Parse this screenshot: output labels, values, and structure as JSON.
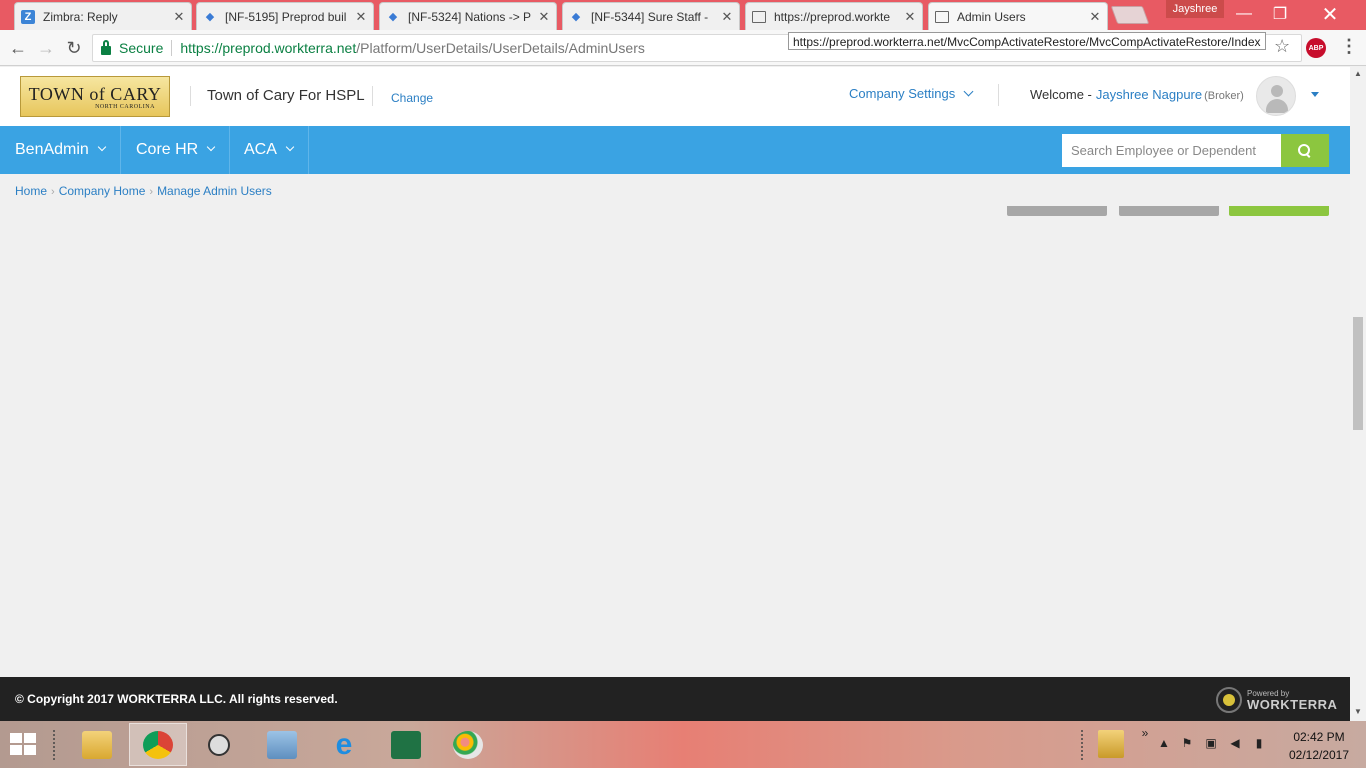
{
  "browser": {
    "tabs": [
      {
        "title": "Zimbra: Reply",
        "icon": "zimbra-icon"
      },
      {
        "title": "[NF-5195] Preprod buil",
        "icon": "jira-icon"
      },
      {
        "title": "[NF-5324] Nations -> P",
        "icon": "jira-icon"
      },
      {
        "title": "[NF-5344] Sure Staff - ",
        "icon": "jira-icon"
      },
      {
        "title": "https://preprod.workte",
        "icon": "page-icon"
      },
      {
        "title": "Admin Users",
        "icon": "page-icon"
      }
    ],
    "profile_name": "Jayshree",
    "secure_label": "Secure",
    "url_host": "https://preprod.workterra.net",
    "url_path": "/Platform/UserDetails/UserDetails/AdminUsers",
    "hover_url": "https://preprod.workterra.net/MvcCompActivateRestore/MvcCompActivateRestore/Index",
    "adblock_label": "ABP"
  },
  "header": {
    "logo_main": "TOWN of CARY",
    "logo_sub": "NORTH CAROLINA",
    "company_name": "Town of Cary For HSPL",
    "change_link": "Change",
    "company_settings": "Company Settings",
    "welcome_prefix": "Welcome -",
    "user_name": "Jayshree Nagpure",
    "user_role": "(Broker)"
  },
  "nav": {
    "items": [
      {
        "label": "BenAdmin"
      },
      {
        "label": "Core HR"
      },
      {
        "label": "ACA"
      }
    ],
    "search_placeholder": "Search Employee or Dependent"
  },
  "breadcrumb": [
    "Home",
    "Company Home",
    "Manage Admin Users"
  ],
  "colors": {
    "brand_blue": "#3aa3e3",
    "link_blue": "#2b7fc4",
    "accent_green": "#8cc63f",
    "footer_bg": "#222222",
    "muted_button": "#a7a7a7"
  },
  "footer": {
    "copyright": "© Copyright 2017 WORKTERRA LLC. All rights reserved.",
    "powered_by": "Powered by",
    "brand": "WORKTERRA"
  },
  "taskbar": {
    "apps": [
      "file-explorer-icon",
      "chrome-icon",
      "magnifier-app-icon",
      "notebook-app-icon",
      "internet-explorer-icon",
      "excel-icon",
      "paint-icon"
    ],
    "time": "02:42 PM",
    "date": "02/12/2017"
  }
}
